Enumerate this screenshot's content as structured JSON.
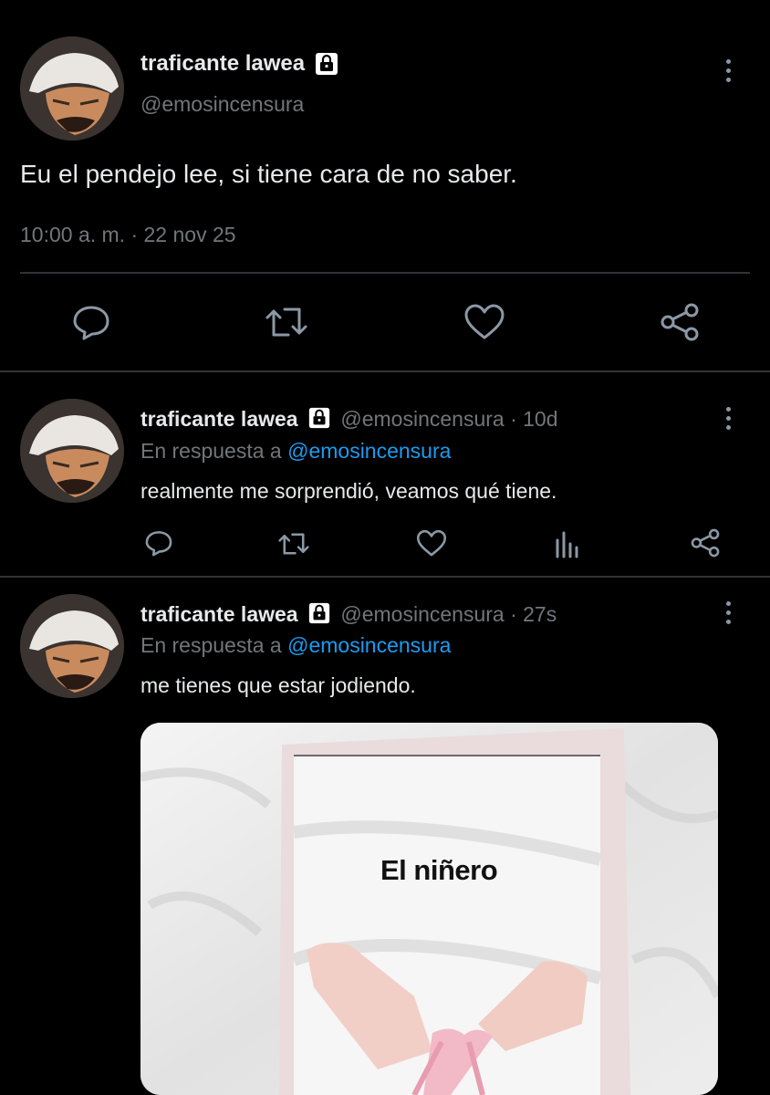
{
  "main_tweet": {
    "display_name": "traficante lawea",
    "handle": "@emosincensura",
    "text": "Eu el pendejo lee, si tiene cara de no saber.",
    "timestamp": "10:00 a. m. · 22 nov 25",
    "actions": [
      "reply-icon",
      "retweet-icon",
      "like-icon",
      "share-icon"
    ]
  },
  "replies": [
    {
      "display_name": "traficante lawea",
      "handle": "@emosincensura",
      "time": "· 10d",
      "reply_prefix": "En respuesta a",
      "reply_to": "@emosincensura",
      "text": "realmente me sorprendió, veamos qué tiene."
    },
    {
      "display_name": "traficante lawea",
      "handle": "@emosincensura",
      "time": "· 27s",
      "reply_prefix": "En respuesta a",
      "reply_to": "@emosincensura",
      "text": "me tienes que estar jodiendo.",
      "media": {
        "book_title": "El niñero"
      }
    }
  ],
  "colors": {
    "background": "#000000",
    "text": "#e7e9ea",
    "secondary": "#71767b",
    "link": "#1d9bf0",
    "divider": "#2f3336"
  }
}
